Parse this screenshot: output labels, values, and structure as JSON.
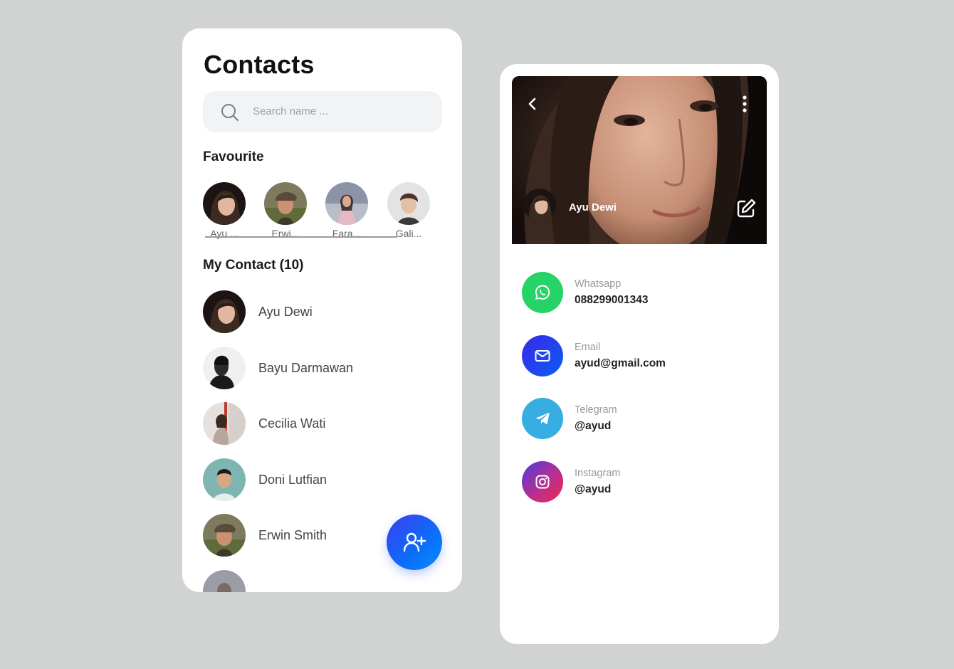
{
  "contacts_screen": {
    "title": "Contacts",
    "search": {
      "placeholder": "Search name ..."
    },
    "favourite_heading": "Favourite",
    "favourites": [
      {
        "label": "Ayu ..."
      },
      {
        "label": "Erwi..."
      },
      {
        "label": "Fara..."
      },
      {
        "label": "Gali..."
      }
    ],
    "my_contact_heading": "My Contact (10)",
    "contacts": [
      {
        "name": "Ayu Dewi"
      },
      {
        "name": "Bayu Darmawan"
      },
      {
        "name": "Cecilia Wati"
      },
      {
        "name": "Doni Lutfian"
      },
      {
        "name": "Erwin Smith"
      }
    ],
    "fab_icon": "add-user-icon"
  },
  "detail_screen": {
    "name": "Ayu Dewi",
    "channels": [
      {
        "label": "Whatsapp",
        "value": "088299001343",
        "icon": "whatsapp-icon",
        "color": "#25d366"
      },
      {
        "label": "Email",
        "value": "ayud@gmail.com",
        "icon": "mail-icon",
        "color": "#1a4dff"
      },
      {
        "label": "Telegram",
        "value": "@ayud",
        "icon": "telegram-icon",
        "color": "#34aadf"
      },
      {
        "label": "Instagram",
        "value": "@ayud",
        "icon": "instagram-icon",
        "color": "#c13584"
      }
    ]
  },
  "colors": {
    "background": "#d1d3d2",
    "accent": "#0a6ef9"
  }
}
